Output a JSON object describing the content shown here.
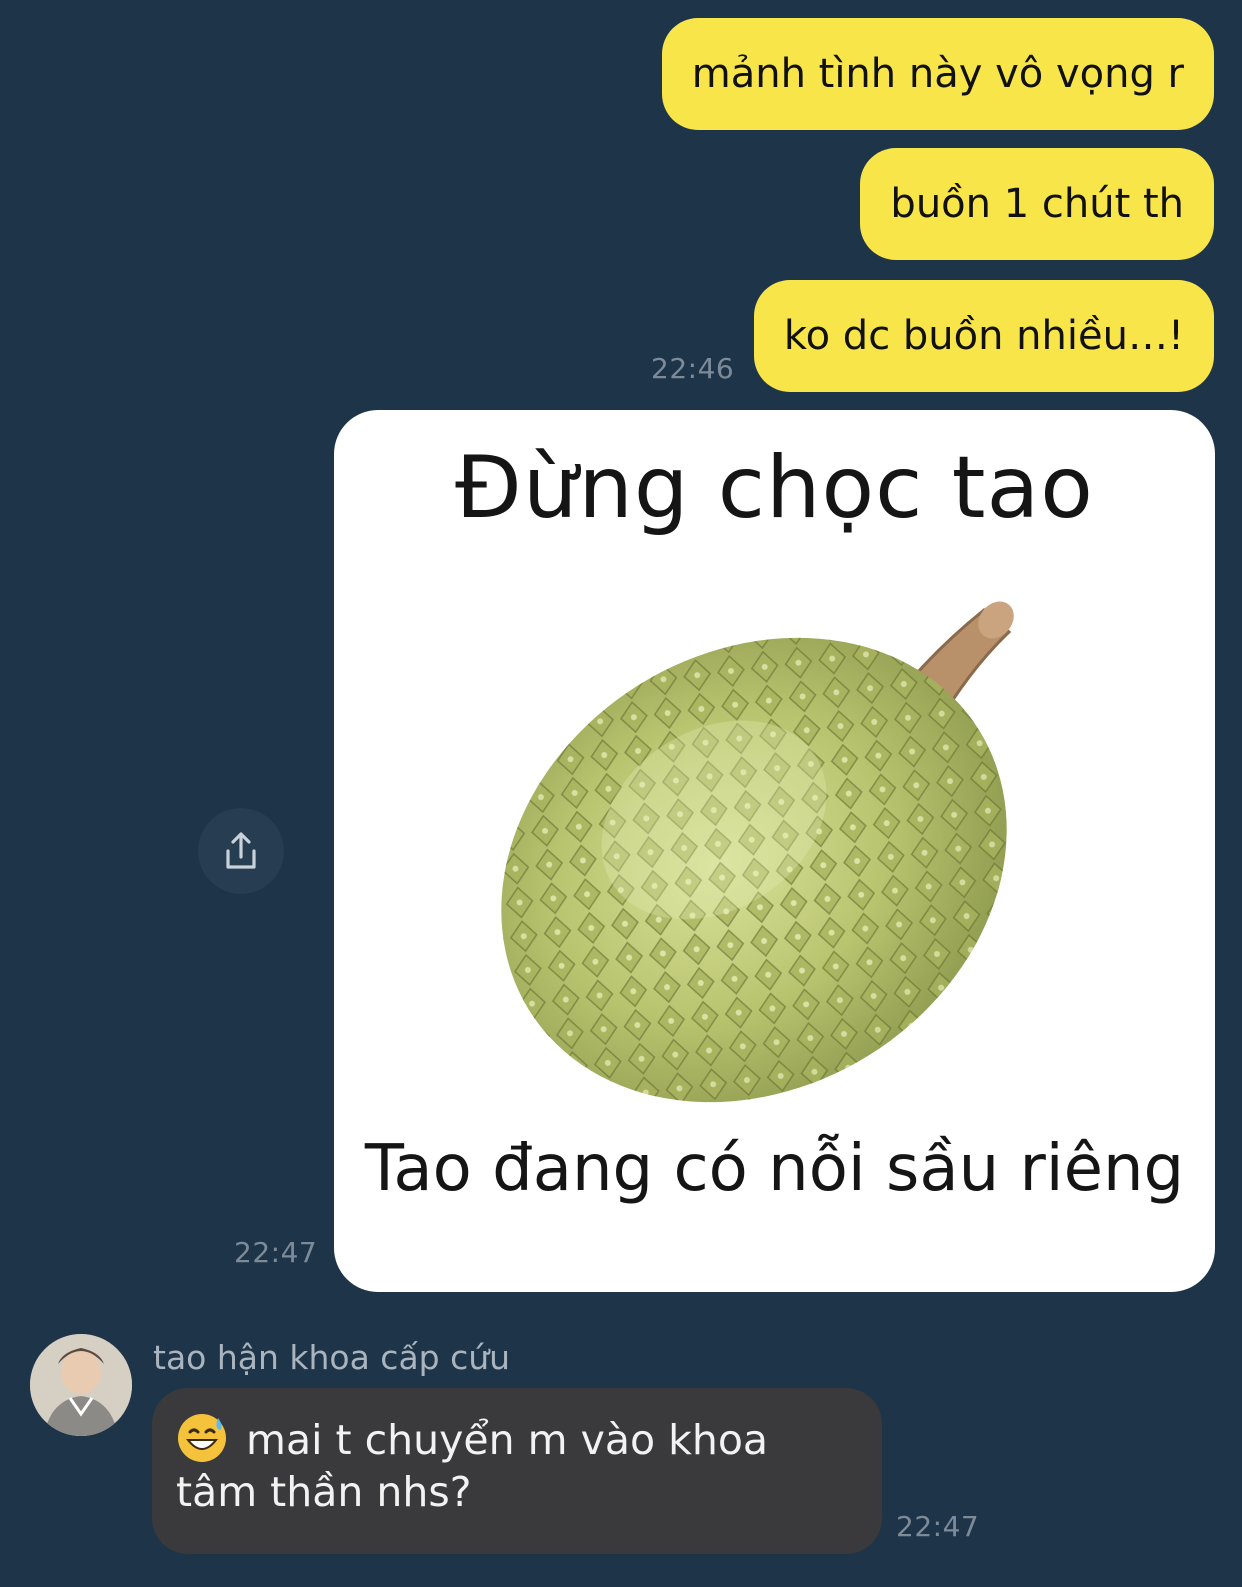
{
  "messages_out": [
    {
      "text": "mảnh tình này vô vọng r"
    },
    {
      "text": "buồn 1 chút th"
    },
    {
      "text": "ko dc buồn nhiều…!"
    }
  ],
  "timestamps": {
    "group_out": "22:46",
    "sticker": "22:47",
    "incoming": "22:47"
  },
  "sticker": {
    "top_text": "Đừng chọc tao",
    "bottom_text": "Tao đang có nỗi sầu riêng",
    "image": "durian"
  },
  "share_button": {
    "icon": "share-icon"
  },
  "incoming": {
    "sender_name": "tao hận khoa cấp cứu",
    "emoji": "grinning-sweat-emoji",
    "text": "mai t chuyển m vào khoa tâm thần nhs?"
  },
  "colors": {
    "background": "#1e3448",
    "outgoing_bubble": "#f8e54a",
    "incoming_bubble": "#3a3a3c",
    "timestamp": "#7d8b99"
  }
}
